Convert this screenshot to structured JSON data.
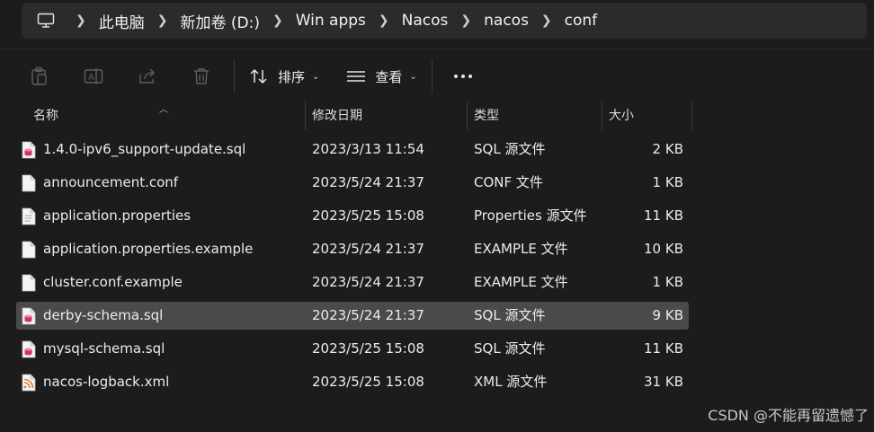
{
  "breadcrumb": {
    "items": [
      "此电脑",
      "新加卷 (D:)",
      "Win apps",
      "Nacos",
      "nacos",
      "conf"
    ]
  },
  "toolbar": {
    "sort_label": "排序",
    "view_label": "查看"
  },
  "columns": {
    "name": "名称",
    "modified": "修改日期",
    "type": "类型",
    "size": "大小"
  },
  "files": [
    {
      "name": "1.4.0-ipv6_support-update.sql",
      "modified": "2023/3/13 11:54",
      "type": "SQL 源文件",
      "size": "2 KB",
      "icon": "sql-file-icon"
    },
    {
      "name": "announcement.conf",
      "modified": "2023/5/24 21:37",
      "type": "CONF 文件",
      "size": "1 KB",
      "icon": "blank-file-icon"
    },
    {
      "name": "application.properties",
      "modified": "2023/5/25 15:08",
      "type": "Properties 源文件",
      "size": "11 KB",
      "icon": "text-file-icon"
    },
    {
      "name": "application.properties.example",
      "modified": "2023/5/24 21:37",
      "type": "EXAMPLE 文件",
      "size": "10 KB",
      "icon": "blank-file-icon"
    },
    {
      "name": "cluster.conf.example",
      "modified": "2023/5/24 21:37",
      "type": "EXAMPLE 文件",
      "size": "1 KB",
      "icon": "blank-file-icon"
    },
    {
      "name": "derby-schema.sql",
      "modified": "2023/5/24 21:37",
      "type": "SQL 源文件",
      "size": "9 KB",
      "icon": "sql-file-icon",
      "selected": true
    },
    {
      "name": "mysql-schema.sql",
      "modified": "2023/5/25 15:08",
      "type": "SQL 源文件",
      "size": "11 KB",
      "icon": "sql-file-icon"
    },
    {
      "name": "nacos-logback.xml",
      "modified": "2023/5/25 15:08",
      "type": "XML 源文件",
      "size": "31 KB",
      "icon": "xml-file-icon"
    }
  ],
  "watermark": "CSDN @不能再留遗憾了",
  "colors": {
    "background": "#1c1c1c",
    "addressbar": "#2b2b2b",
    "selected_row": "#4a4a4a",
    "sql_icon": "#d0306a",
    "xml_icon": "#e07b2e"
  }
}
